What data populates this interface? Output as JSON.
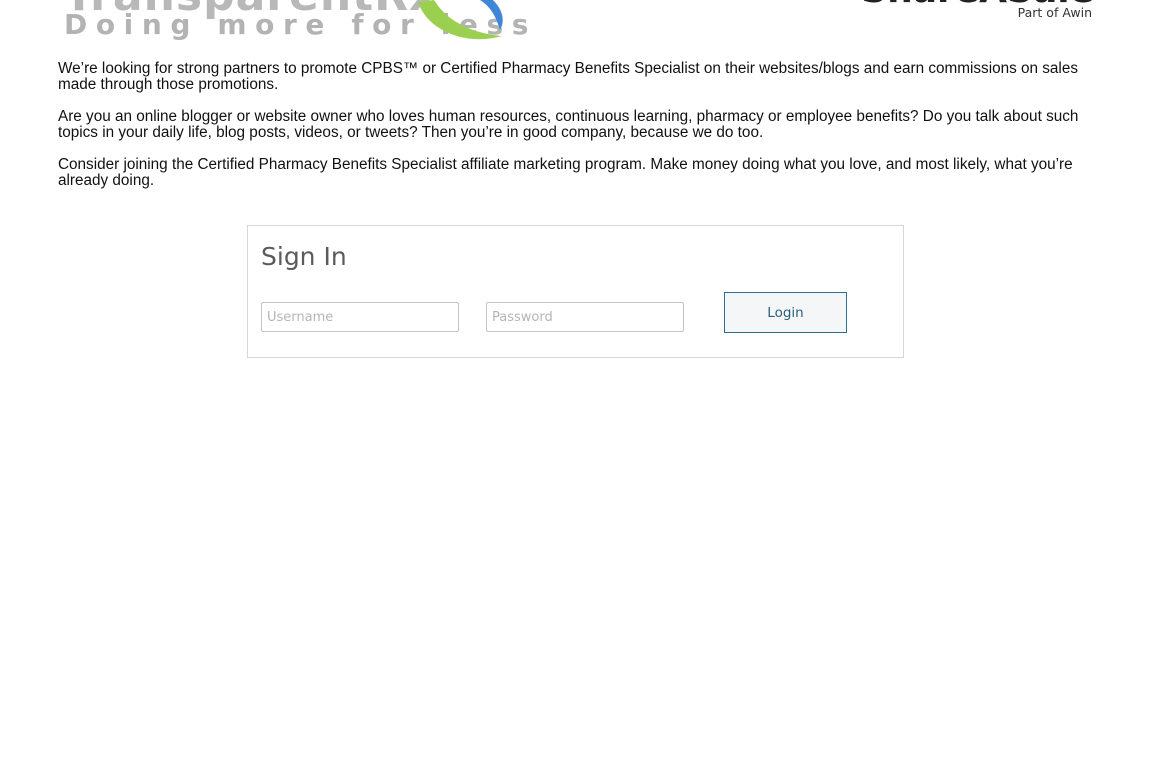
{
  "header": {
    "brand": {
      "wordmark": "TransparentRx",
      "tagline": "Doing more for less"
    },
    "partner": {
      "name": "ShareASale",
      "subtitle": "Part of Awin"
    }
  },
  "intro": {
    "paragraphs": [
      "We’re looking for strong partners to promote CPBS™ or Certified Pharmacy Benefits Specialist on their websites/blogs and earn commissions on sales made through those promotions.",
      "Are you an online blogger or website owner who loves human resources, continuous learning, pharmacy or employee benefits? Do you talk about such topics in your daily life, blog posts, videos, or tweets? Then you’re in good company, because we do too.",
      "Consider joining the Certified Pharmacy Benefits Specialist affiliate marketing program. Make money doing what you love, and most likely, what you’re already doing."
    ]
  },
  "signin": {
    "title": "Sign In",
    "username_placeholder": "Username",
    "username_value": "",
    "password_placeholder": "Password",
    "password_value": "",
    "login_label": "Login"
  },
  "colors": {
    "swoosh_green": "#9bcf4f",
    "swoosh_blue": "#3f86d8",
    "login_border": "#2f6f8f"
  }
}
